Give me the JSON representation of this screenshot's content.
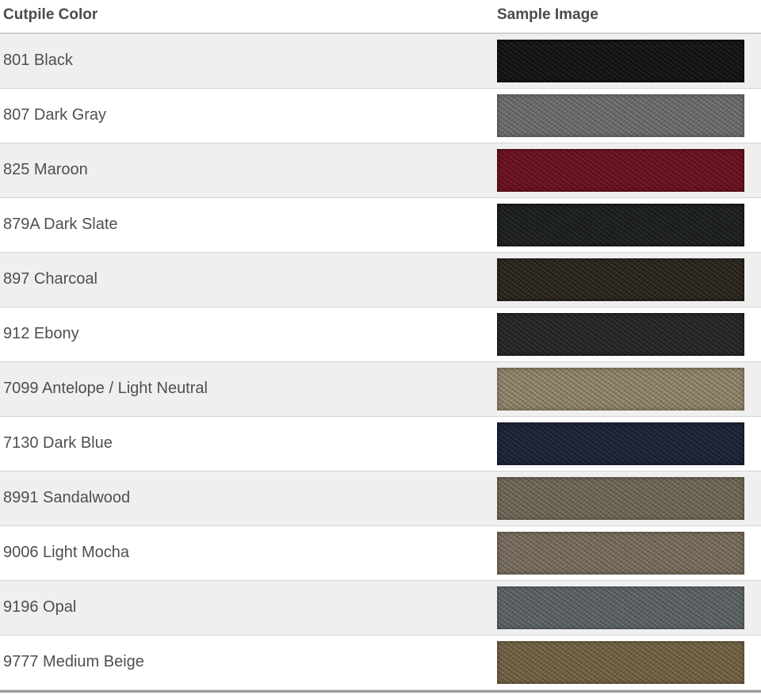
{
  "header": {
    "color_label": "Cutpile Color",
    "sample_label": "Sample Image"
  },
  "rows": [
    {
      "name": "801 Black",
      "swatch": {
        "base": "#141414",
        "light": "#3a3a3a",
        "dark": "#050505",
        "icon": "carpet-swatch-black"
      }
    },
    {
      "name": "807 Dark Gray",
      "swatch": {
        "base": "#6a6a6a",
        "light": "#9a9a9a",
        "dark": "#454545",
        "icon": "carpet-swatch-dark-gray"
      }
    },
    {
      "name": "825 Maroon",
      "swatch": {
        "base": "#6a1420",
        "light": "#a0283a",
        "dark": "#3a0810",
        "icon": "carpet-swatch-maroon"
      }
    },
    {
      "name": "879A Dark Slate",
      "swatch": {
        "base": "#1e2020",
        "light": "#3e4242",
        "dark": "#0c0d0d",
        "icon": "carpet-swatch-dark-slate"
      }
    },
    {
      "name": "897 Charcoal",
      "swatch": {
        "base": "#2a2520",
        "light": "#5a5244",
        "dark": "#13100c",
        "icon": "carpet-swatch-charcoal"
      }
    },
    {
      "name": "912 Ebony",
      "swatch": {
        "base": "#262828",
        "light": "#4a4c4c",
        "dark": "#101212",
        "icon": "carpet-swatch-ebony"
      }
    },
    {
      "name": "7099 Antelope / Light Neutral",
      "swatch": {
        "base": "#8c8068",
        "light": "#c2b698",
        "dark": "#5a503e",
        "icon": "carpet-swatch-antelope"
      }
    },
    {
      "name": "7130 Dark Blue",
      "swatch": {
        "base": "#1c2434",
        "light": "#3c4a64",
        "dark": "#0c111c",
        "icon": "carpet-swatch-dark-blue"
      }
    },
    {
      "name": "8991 Sandalwood",
      "swatch": {
        "base": "#6c6656",
        "light": "#9c9480",
        "dark": "#443f33",
        "icon": "carpet-swatch-sandalwood"
      }
    },
    {
      "name": "9006 Light Mocha",
      "swatch": {
        "base": "#756a5c",
        "light": "#a69a88",
        "dark": "#4a4238",
        "icon": "carpet-swatch-light-mocha"
      }
    },
    {
      "name": "9196 Opal",
      "swatch": {
        "base": "#5a6062",
        "light": "#8a9294",
        "dark": "#3a3e40",
        "icon": "carpet-swatch-opal"
      }
    },
    {
      "name": "9777 Medium Beige",
      "swatch": {
        "base": "#6e6042",
        "light": "#a09070",
        "dark": "#463c28",
        "icon": "carpet-swatch-medium-beige"
      }
    }
  ]
}
